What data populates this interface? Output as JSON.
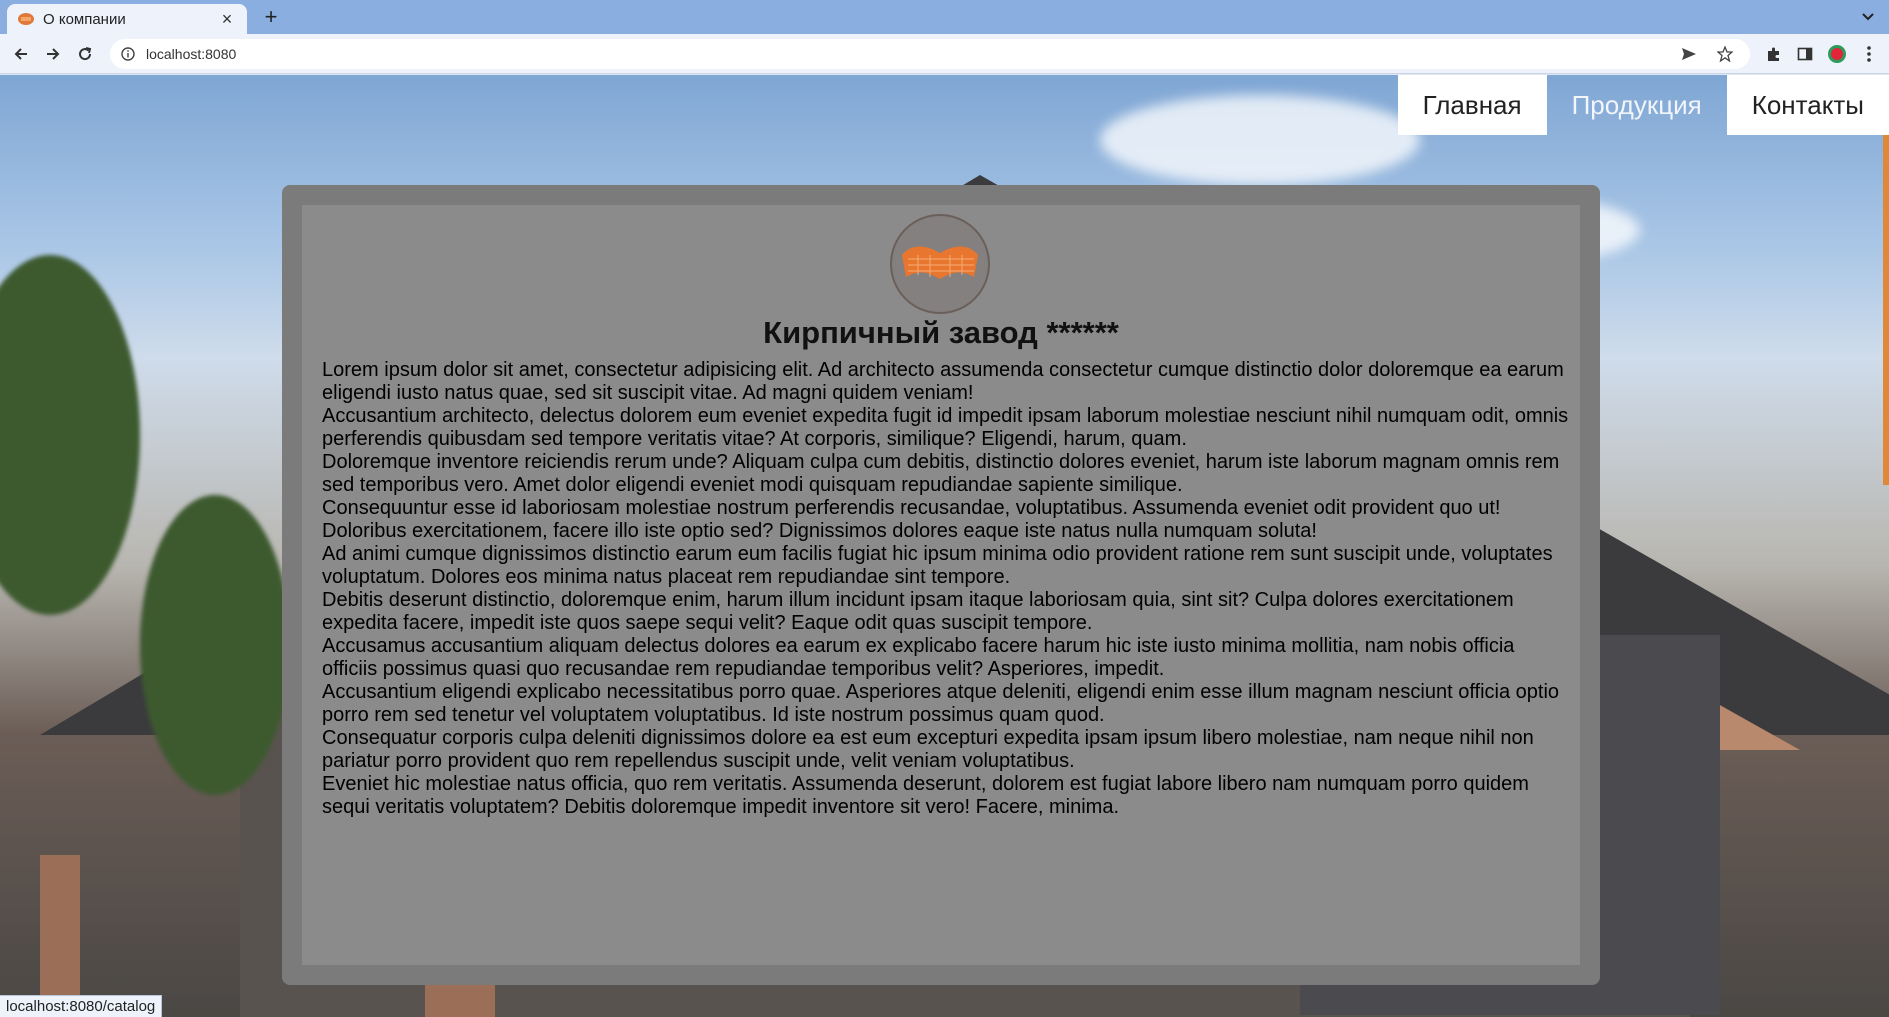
{
  "browser": {
    "tab_title": "О компании",
    "url": "localhost:8080",
    "status_url": "localhost:8080/catalog"
  },
  "nav": {
    "home": "Главная",
    "products": "Продукция",
    "contacts": "Контакты"
  },
  "company": {
    "title": "Кирпичный завод ******",
    "paragraphs": [
      "Lorem ipsum dolor sit amet, consectetur adipisicing elit. Ad architecto assumenda consectetur cumque distinctio dolor doloremque ea earum eligendi iusto natus quae, sed sit suscipit vitae. Ad magni quidem veniam!",
      "Accusantium architecto, delectus dolorem eum eveniet expedita fugit id impedit ipsam laborum molestiae nesciunt nihil numquam odit, omnis perferendis quibusdam sed tempore veritatis vitae? At corporis, similique? Eligendi, harum, quam.",
      "Doloremque inventore reiciendis rerum unde? Aliquam culpa cum debitis, distinctio dolores eveniet, harum iste laborum magnam omnis rem sed temporibus vero. Amet dolor eligendi eveniet modi quisquam repudiandae sapiente similique.",
      "Consequuntur esse id laboriosam molestiae nostrum perferendis recusandae, voluptatibus. Assumenda eveniet odit provident quo ut! Doloribus exercitationem, facere illo iste optio sed? Dignissimos dolores eaque iste natus nulla numquam soluta!",
      "Ad animi cumque dignissimos distinctio earum eum facilis fugiat hic ipsum minima odio provident ratione rem sunt suscipit unde, voluptates voluptatum. Dolores eos minima natus placeat rem repudiandae sint tempore.",
      "Debitis deserunt distinctio, doloremque enim, harum illum incidunt ipsam itaque laboriosam quia, sint sit? Culpa dolores exercitationem expedita facere, impedit iste quos saepe sequi velit? Eaque odit quas suscipit tempore.",
      "Accusamus accusantium aliquam delectus dolores ea earum ex explicabo facere harum hic iste iusto minima mollitia, nam nobis officia officiis possimus quasi quo recusandae rem repudiandae temporibus velit? Asperiores, impedit.",
      "Accusantium eligendi explicabo necessitatibus porro quae. Asperiores atque deleniti, eligendi enim esse illum magnam nesciunt officia optio porro rem sed tenetur vel voluptatem voluptatibus. Id iste nostrum possimus quam quod.",
      "Consequatur corporis culpa deleniti dignissimos dolore ea est eum excepturi expedita ipsam ipsum libero molestiae, nam neque nihil non pariatur porro provident quo rem repellendus suscipit unde, velit veniam voluptatibus.",
      "Eveniet hic molestiae natus officia, quo rem veritatis. Assumenda deserunt, dolorem est fugiat labore libero nam numquam porro quidem sequi veritatis voluptatem? Debitis doloremque impedit inventore sit vero! Facere, minima."
    ]
  },
  "colors": {
    "tabbar": "#8aaedf",
    "card_frame": "#7b7b7b",
    "accent_orange": "#e0883a"
  },
  "icons": [
    "brick-favicon-icon",
    "close-icon",
    "plus-icon",
    "chevron-down-icon",
    "back-arrow-icon",
    "forward-arrow-icon",
    "reload-icon",
    "info-icon",
    "send-icon",
    "star-icon",
    "puzzle-extensions-icon",
    "sidebar-icon",
    "profile-icon",
    "kebab-menu-icon",
    "brick-logo-icon"
  ]
}
